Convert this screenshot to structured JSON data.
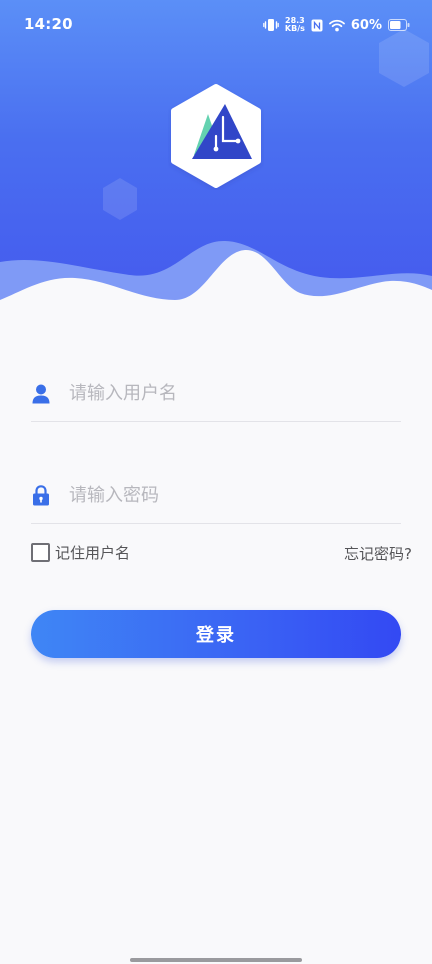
{
  "status_bar": {
    "time": "14:20",
    "net_speed_value": "28.3",
    "net_speed_unit": "KB/s",
    "battery_percent": "60%",
    "icons": [
      "vibrate-icon",
      "nfc-icon",
      "wifi-icon",
      "battery-icon"
    ]
  },
  "login_form": {
    "username_placeholder": "请输入用户名",
    "password_placeholder": "请输入密码",
    "remember_label": "记住用户名",
    "remember_checked": false,
    "forgot_label": "忘记密码?",
    "login_label": "登录"
  },
  "colors": {
    "header_top": "#5b8ff7",
    "header_bottom": "#4459ee",
    "accent_blue": "#3a62f4",
    "logo_green": "#64d2b0",
    "logo_navy": "#3146c8"
  }
}
